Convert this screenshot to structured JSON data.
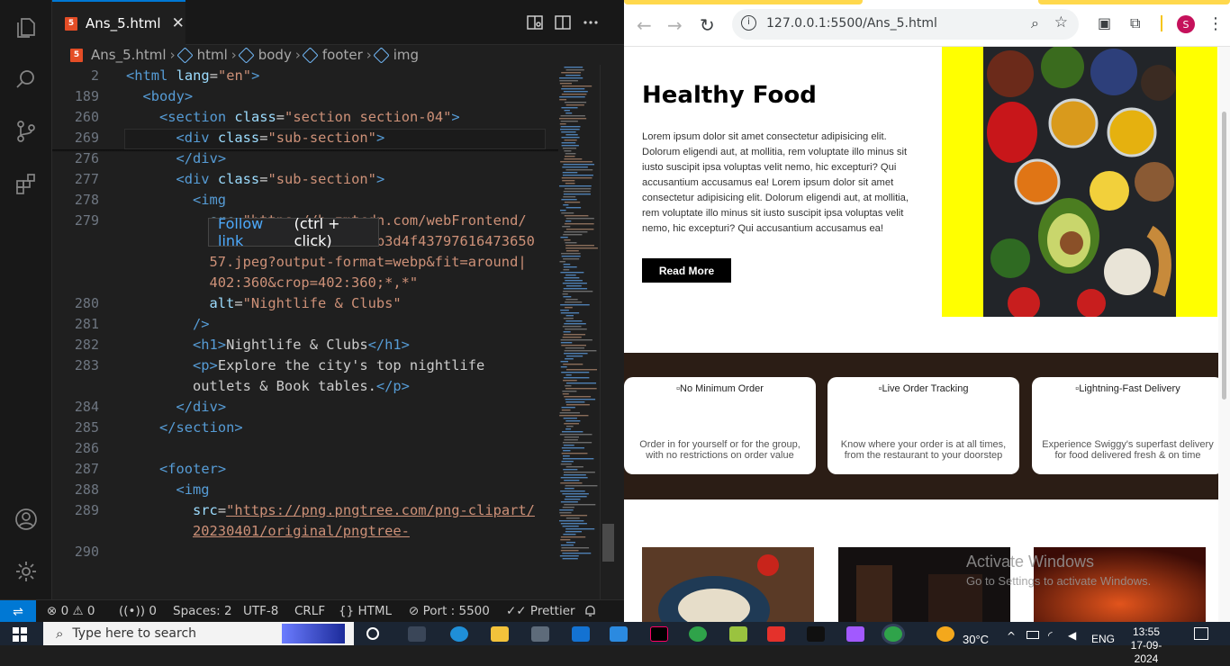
{
  "editor": {
    "tab_title": "Ans_5.html",
    "breadcrumb": [
      "Ans_5.html",
      "html",
      "body",
      "footer",
      "img"
    ],
    "hover_tooltip": {
      "link": "Follow link",
      "hint": "(ctrl + click)"
    },
    "lines": [
      {
        "no": "2",
        "indent": 0,
        "html": "<span class='tg'>&lt;html</span> <span class='at'>lang</span>=<span class='st'>\"en\"</span><span class='tg'>&gt;</span>"
      },
      {
        "no": "189",
        "indent": 1,
        "html": "<span class='tg'>&lt;body&gt;</span>"
      },
      {
        "no": "260",
        "indent": 2,
        "html": "<span class='tg'>&lt;section</span> <span class='at'>class</span>=<span class='st'>\"section section-04\"</span><span class='tg'>&gt;</span>"
      },
      {
        "no": "269",
        "indent": 3,
        "html": "<span class='tg'>&lt;div</span> <span class='at'>class</span>=<span class='st'>\"sub-section\"</span><span class='tg'>&gt;</span>"
      },
      {
        "no": "276",
        "indent": 3,
        "html": "<span class='tg'>&lt;/div&gt;</span>"
      },
      {
        "no": "277",
        "indent": 3,
        "html": "<span class='tg'>&lt;div</span> <span class='at'>class</span>=<span class='st'>\"sub-section\"</span><span class='tg'>&gt;</span>"
      },
      {
        "no": "278",
        "indent": 4,
        "html": "<span class='tg'>&lt;img</span>"
      },
      {
        "no": "279",
        "indent": 5,
        "html": "<span class='at'>src</span>=<span class='st'>\"https://b.zmtcdn.com/webFrontend/</span>"
      },
      {
        "no": "",
        "indent": 5,
        "html": "<span class='st'>                    b3d4f43797616473650</span>"
      },
      {
        "no": "",
        "indent": 5,
        "html": "<span class='st'>57.jpeg?output-format=webp&amp;fit=around|</span>"
      },
      {
        "no": "",
        "indent": 5,
        "html": "<span class='st'>402:360&amp;crop=402:360;*,*\"</span>"
      },
      {
        "no": "280",
        "indent": 5,
        "html": "<span class='at'>alt</span>=<span class='st'>\"Nightlife &amp; Clubs\"</span>"
      },
      {
        "no": "281",
        "indent": 4,
        "html": "<span class='tg'>/&gt;</span>"
      },
      {
        "no": "282",
        "indent": 4,
        "html": "<span class='tg'>&lt;h1&gt;</span>Nightlife &amp; Clubs<span class='tg'>&lt;/h1&gt;</span>"
      },
      {
        "no": "283",
        "indent": 4,
        "html": "<span class='tg'>&lt;p&gt;</span>Explore the city's top nightlife"
      },
      {
        "no": "",
        "indent": 4,
        "html": "outlets &amp; Book tables.<span class='tg'>&lt;/p&gt;</span>"
      },
      {
        "no": "284",
        "indent": 3,
        "html": "<span class='tg'>&lt;/div&gt;</span>"
      },
      {
        "no": "285",
        "indent": 2,
        "html": "<span class='tg'>&lt;/section&gt;</span>"
      },
      {
        "no": "286",
        "indent": 2,
        "html": ""
      },
      {
        "no": "287",
        "indent": 2,
        "html": "<span class='tg'>&lt;footer&gt;</span>"
      },
      {
        "no": "288",
        "indent": 3,
        "html": "<span class='tg'>&lt;img</span>"
      },
      {
        "no": "289",
        "indent": 4,
        "html": "<span class='at'>src</span>=<span class='st' style='text-decoration:underline'>\"https://png.pngtree.com/png-clipart/</span>"
      },
      {
        "no": "",
        "indent": 4,
        "html": "<span class='st' style='text-decoration:underline'>20230401/original/pngtree-</span>"
      },
      {
        "no": "290",
        "indent": 3,
        "html": ""
      }
    ],
    "status": {
      "errors": "0",
      "warnings": "0",
      "ports": "0",
      "spaces": "Spaces: 2",
      "encoding": "UTF-8",
      "eol": "CRLF",
      "language": "HTML",
      "port": "Port : 5500",
      "prettier": "Prettier"
    }
  },
  "browser": {
    "url": "127.0.0.1:5500/Ans_5.html",
    "profile_initial": "S",
    "hero": {
      "title": "Healthy Food",
      "text": "Lorem ipsum dolor sit amet consectetur adipisicing elit. Dolorum eligendi aut, at mollitia, rem voluptate illo minus sit iusto suscipit ipsa voluptas velit nemo, hic excepturi? Qui accusantium accusamus ea! Lorem ipsum dolor sit amet consectetur adipisicing elit. Dolorum eligendi aut, at mollitia, rem voluptate illo minus sit iusto suscipit ipsa voluptas velit nemo, hic excepturi? Qui accusantium accusamus ea!",
      "button": "Read More"
    },
    "features": [
      {
        "alt": "No Minimum Order",
        "desc": "Order in for yourself or for the group, with no restrictions on order value"
      },
      {
        "alt": "Live Order Tracking",
        "desc": "Know where your order is at all times, from the restaurant to your doorstep"
      },
      {
        "alt": "Lightning-Fast Delivery",
        "desc": "Experience Swiggy's superfast delivery for food delivered fresh & on time"
      }
    ]
  },
  "watermark": {
    "title": "Activate Windows",
    "subtitle": "Go to Settings to activate Windows."
  },
  "taskbar": {
    "search_placeholder": "Type here to search",
    "temperature": "30°C",
    "language": "ENG",
    "time": "13:55",
    "date": "17-09-2024"
  },
  "colors": {
    "accent": "#0078d4",
    "hero_bg": "#ffff00",
    "features_bg": "#2b1d15"
  }
}
